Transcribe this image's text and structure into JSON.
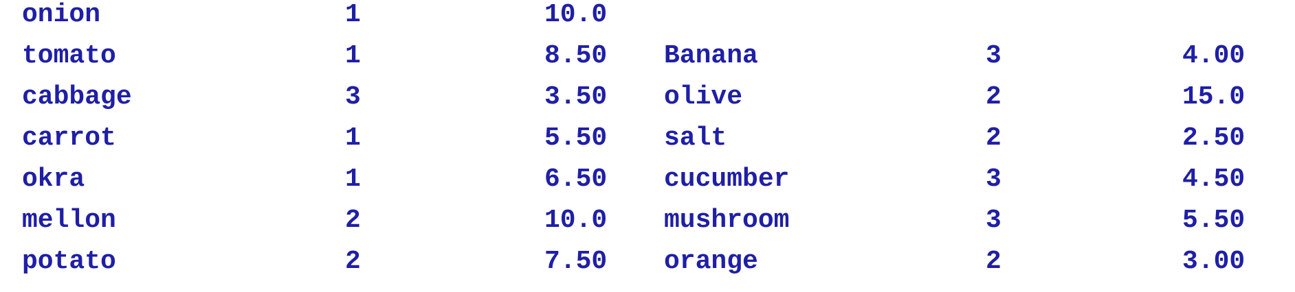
{
  "color": "#1f1fa6",
  "rows": [
    {
      "left": {
        "name": "onion",
        "qty": "1",
        "price": "10.0"
      },
      "right": {
        "name": "",
        "qty": "",
        "price": ""
      }
    },
    {
      "left": {
        "name": "tomato",
        "qty": "1",
        "price": "8.50"
      },
      "right": {
        "name": "Banana",
        "qty": "3",
        "price": "4.00"
      }
    },
    {
      "left": {
        "name": "cabbage",
        "qty": "3",
        "price": "3.50"
      },
      "right": {
        "name": "olive",
        "qty": "2",
        "price": "15.0"
      }
    },
    {
      "left": {
        "name": "carrot",
        "qty": "1",
        "price": "5.50"
      },
      "right": {
        "name": "salt",
        "qty": "2",
        "price": "2.50"
      }
    },
    {
      "left": {
        "name": "okra",
        "qty": "1",
        "price": "6.50"
      },
      "right": {
        "name": "cucumber",
        "qty": "3",
        "price": "4.50"
      }
    },
    {
      "left": {
        "name": "mellon",
        "qty": "2",
        "price": "10.0"
      },
      "right": {
        "name": "mushroom",
        "qty": "3",
        "price": "5.50"
      }
    },
    {
      "left": {
        "name": "potato",
        "qty": "2",
        "price": "7.50"
      },
      "right": {
        "name": "orange",
        "qty": "2",
        "price": "3.00"
      }
    }
  ]
}
